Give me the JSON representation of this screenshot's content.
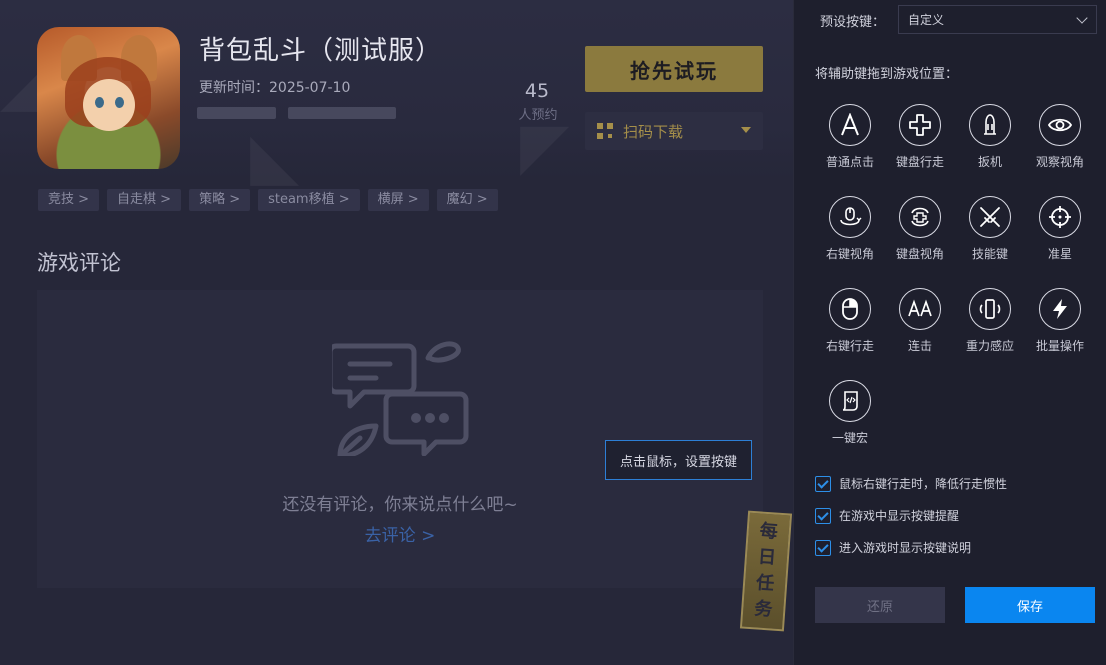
{
  "game": {
    "title": "背包乱斗（测试服）",
    "update_label": "更新时间：",
    "update_date": "2025-07-10",
    "reserve_count": "45",
    "reserve_label": "人预约",
    "play_button": "抢先试玩",
    "qr_button": "扫码下载",
    "tags": [
      "竞技 >",
      "自走棋 >",
      "策略 >",
      "steam移植 >",
      "横屏 >",
      "魔幻 >"
    ]
  },
  "comments": {
    "section_title": "游戏评论",
    "empty_text": "还没有评论，你来说点什么吧~",
    "go_comment": "去评论 >"
  },
  "tooltip": "点击鼠标，设置按键",
  "daily_task": [
    "每",
    "日",
    "任",
    "务"
  ],
  "key_panel": {
    "preset_label": "预设按键：",
    "preset_value": "自定义",
    "drag_hint": "将辅助键拖到游戏位置：",
    "keys": [
      {
        "label": "普通点击",
        "icon": "letter-a-icon"
      },
      {
        "label": "键盘行走",
        "icon": "dpad-icon"
      },
      {
        "label": "扳机",
        "icon": "trigger-icon"
      },
      {
        "label": "观察视角",
        "icon": "eye-icon"
      },
      {
        "label": "右键视角",
        "icon": "mouse-orbit-icon"
      },
      {
        "label": "键盘视角",
        "icon": "keyboard-orbit-icon"
      },
      {
        "label": "技能键",
        "icon": "crossed-swords-icon"
      },
      {
        "label": "准星",
        "icon": "crosshair-icon"
      },
      {
        "label": "右键行走",
        "icon": "mouse-icon"
      },
      {
        "label": "连击",
        "icon": "double-a-icon"
      },
      {
        "label": "重力感应",
        "icon": "phone-tilt-icon"
      },
      {
        "label": "批量操作",
        "icon": "lightning-icon"
      },
      {
        "label": "一键宏",
        "icon": "macro-script-icon"
      }
    ],
    "options": [
      {
        "label": "鼠标右键行走时，降低行走惯性",
        "checked": true
      },
      {
        "label": "在游戏中显示按键提醒",
        "checked": true
      },
      {
        "label": "进入游戏时显示按键说明",
        "checked": true
      }
    ],
    "reset_button": "还原",
    "save_button": "保存"
  },
  "colors": {
    "accent": "#0a86f0",
    "gold": "#8b7a3e",
    "panel_bg": "#1e1f2d",
    "page_bg": "#262739"
  }
}
